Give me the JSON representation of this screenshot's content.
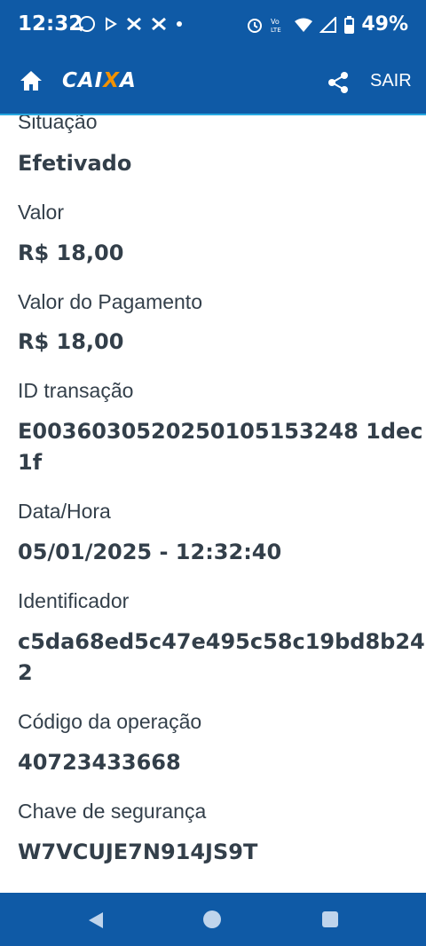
{
  "status_bar": {
    "time": "12:32",
    "battery": "49%",
    "icons": [
      "whatsapp-icon",
      "play-icon",
      "x-icon",
      "x-icon",
      "dot-icon",
      "alarm-icon",
      "volte-icon",
      "wifi-icon",
      "signal-icon",
      "battery-icon"
    ]
  },
  "header": {
    "logo_text_left": "CAI",
    "logo_text_x": "X",
    "logo_text_right": "A",
    "sair_label": "SAIR",
    "colors": {
      "bar": "#0f5aa6",
      "accent": "#27a8e0",
      "logo_x": "#f39200"
    }
  },
  "details": {
    "situacao_label": "Situação",
    "situacao_value": "Efetivado",
    "valor_label": "Valor",
    "valor_value": "R$ 18,00",
    "valor_pagamento_label": "Valor do Pagamento",
    "valor_pagamento_value": "R$ 18,00",
    "id_transacao_label": "ID transação",
    "id_transacao_line1": "E0036030520250105153248 1dec",
    "id_transacao_line2": "1f",
    "data_hora_label": "Data/Hora",
    "data_hora_value": "05/01/2025 - 12:32:40",
    "identificador_label": "Identificador",
    "identificador_line1": "c5da68ed5c47e495c58c19bd8b24",
    "identificador_line2": "2",
    "codigo_label": "Código da operação",
    "codigo_value": "40723433668",
    "chave_label": "Chave de segurança",
    "chave_value": "W7VCUJE7N914JS9T"
  }
}
